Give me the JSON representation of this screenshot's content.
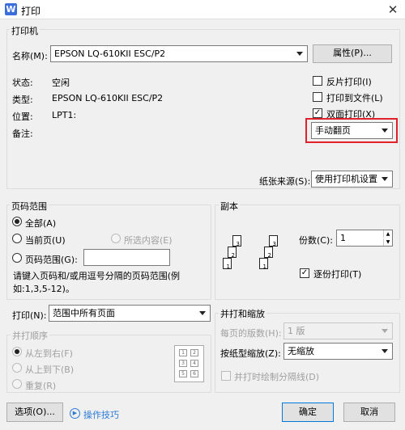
{
  "window": {
    "title": "打印",
    "app_icon": "W",
    "close": "✕"
  },
  "printer": {
    "group_label": "打印机",
    "name_label": "名称(M):",
    "name_value": "EPSON LQ-610KII ESC/P2",
    "properties_button": "属性(P)...",
    "status_label": "状态:",
    "status_value": "空闲",
    "type_label": "类型:",
    "type_value": "EPSON LQ-610KII ESC/P2",
    "location_label": "位置:",
    "location_value": "LPT1:",
    "comment_label": "备注:",
    "reverse_print": "反片打印(I)",
    "print_to_file": "打印到文件(L)",
    "duplex": "双面打印(X)",
    "duplex_mode": "手动翻页",
    "paper_source_label": "纸张来源(S):",
    "paper_source_value": "使用打印机设置"
  },
  "page_range": {
    "group_label": "页码范围",
    "all": "全部(A)",
    "current": "当前页(U)",
    "selection": "所选内容(E)",
    "range": "页码范围(G):",
    "range_value": "",
    "hint": "请键入页码和/或用逗号分隔的页码范围(例如:1,3,5-12)。"
  },
  "copies": {
    "group_label": "副本",
    "count_label": "份数(C):",
    "count_value": "1",
    "collate": "逐份打印(T)",
    "page_numbers": [
      "1",
      "2",
      "3"
    ]
  },
  "print_what": {
    "label": "打印(N):",
    "value": "范围中所有页面",
    "order_label": "并打顺序",
    "order_options": [
      "从左到右(F)",
      "从上到下(B)",
      "重复(R)"
    ],
    "thumbnail_numbers": [
      "1",
      "2",
      "3",
      "4",
      "5",
      "6"
    ]
  },
  "zoom": {
    "group_label": "并打和缩放",
    "pages_per_sheet_label": "每页的版数(H):",
    "pages_per_sheet_value": "1 版",
    "scale_label": "按纸型缩放(Z):",
    "scale_value": "无缩放",
    "draw_borders": "并打时绘制分隔线(D)"
  },
  "footer": {
    "options_button": "选项(O)...",
    "tips_link": "操作技巧",
    "ok_button": "确定",
    "cancel_button": "取消"
  },
  "colors": {
    "highlight": "#e0212b",
    "accent": "#0078d7"
  }
}
